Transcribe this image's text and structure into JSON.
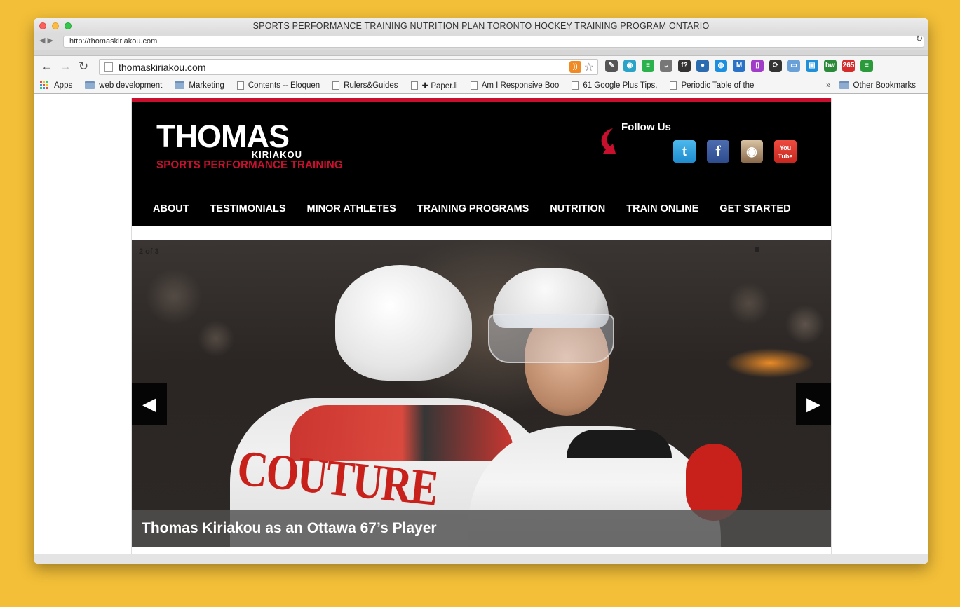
{
  "window": {
    "title": "SPORTS PERFORMANCE TRAINING NUTRITION PLAN TORONTO HOCKEY TRAINING PROGRAM ONTARIO",
    "outer_url": "http://thomaskiriakou.com",
    "outer_back": "◀",
    "outer_forward": "▶",
    "reload_glyph": "↻"
  },
  "toolbar": {
    "back": "←",
    "forward": "→",
    "reload": "↻",
    "url": "thomaskiriakou.com",
    "rss": "))",
    "star": "☆",
    "extensions": [
      {
        "name": "eyedropper",
        "glyph": "✎",
        "color": "#555"
      },
      {
        "name": "eye",
        "glyph": "◉",
        "color": "#29a3c8"
      },
      {
        "name": "feedly",
        "glyph": "≡",
        "color": "#2bb24c"
      },
      {
        "name": "pocket",
        "glyph": "⌄",
        "color": "#777"
      },
      {
        "name": "whatfont",
        "glyph": "f?",
        "color": "#333"
      },
      {
        "name": "colorzilla",
        "glyph": "●",
        "color": "#2b6cb0"
      },
      {
        "name": "chat",
        "glyph": "◍",
        "color": "#1d8fe1"
      },
      {
        "name": "mx",
        "glyph": "M",
        "color": "#2a73c7"
      },
      {
        "name": "phone",
        "glyph": "▯",
        "color": "#a03cc8"
      },
      {
        "name": "sync",
        "glyph": "⟳",
        "color": "#333"
      },
      {
        "name": "window",
        "glyph": "▭",
        "color": "#6aa0d8"
      },
      {
        "name": "box",
        "glyph": "▣",
        "color": "#2090d8"
      },
      {
        "name": "bw",
        "glyph": "bw",
        "color": "#2a8a3a"
      },
      {
        "name": "counter",
        "glyph": "265",
        "color": "#d42b2b"
      },
      {
        "name": "menu",
        "glyph": "≡",
        "color": "#2a9a3a"
      }
    ]
  },
  "bookmarks": {
    "items": [
      {
        "label": "Apps",
        "type": "apps"
      },
      {
        "label": "web development",
        "type": "folder"
      },
      {
        "label": "Marketing",
        "type": "folder"
      },
      {
        "label": "Contents -- Eloquen",
        "type": "page"
      },
      {
        "label": "Rulers&Guides",
        "type": "page"
      },
      {
        "label": "✚ Paper.li",
        "type": "page"
      },
      {
        "label": "Am I Responsive Boo",
        "type": "page"
      },
      {
        "label": "61 Google Plus Tips,",
        "type": "page"
      },
      {
        "label": "Periodic Table of the",
        "type": "page"
      }
    ],
    "more": "»",
    "other": "Other Bookmarks"
  },
  "site": {
    "logo_main": "THOMAS",
    "logo_sub": "KIRIAKOU",
    "logo_tag": "SPORTS PERFORMANCE TRAINING",
    "follow_label": "Follow Us",
    "social": {
      "twitter": "t",
      "facebook": "f",
      "instagram": "◉",
      "youtube": "You\nTube"
    },
    "nav": [
      "ABOUT",
      "TESTIMONIALS",
      "MINOR ATHLETES",
      "TRAINING PROGRAMS",
      "NUTRITION",
      "TRAIN ONLINE",
      "GET STARTED"
    ]
  },
  "slider": {
    "counter": "2 of 3",
    "prev": "◀",
    "next": "▶",
    "caption": "Thomas Kiriakou as an Ottawa 67’s Player",
    "jersey_left": "COUTURE"
  }
}
